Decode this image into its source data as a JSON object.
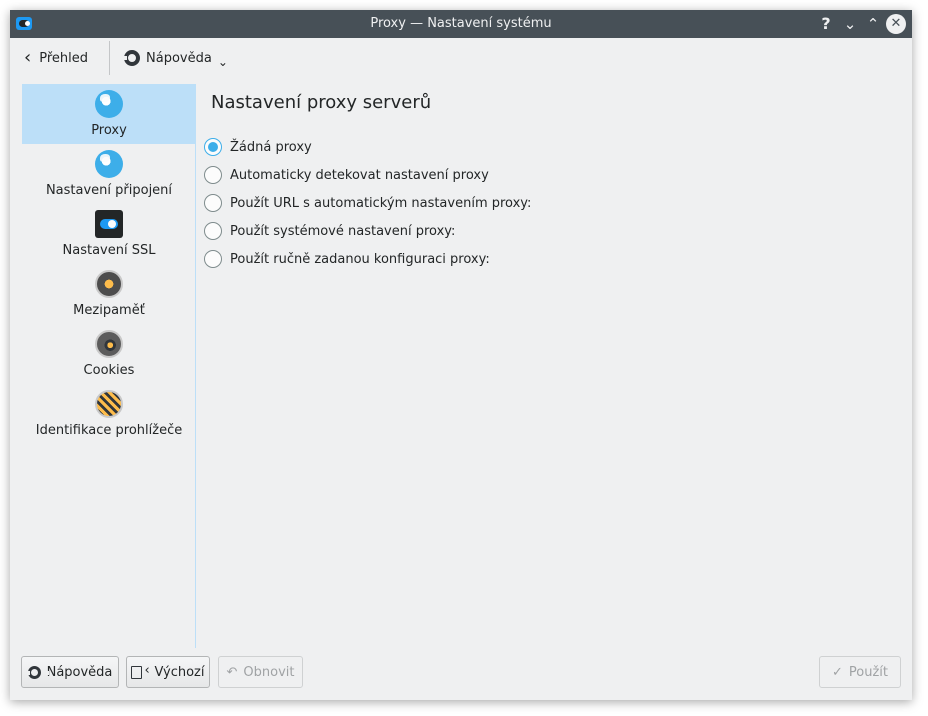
{
  "window": {
    "title": "Proxy  — Nastavení systému"
  },
  "titlebar_buttons": {
    "help": "?",
    "minimize": "⌄",
    "maximize": "⌃",
    "close": "✕"
  },
  "toolbar": {
    "back_label": "Přehled",
    "help_label": "Nápověda"
  },
  "sidebar": {
    "items": [
      {
        "label": "Proxy",
        "icon": "globe-icon",
        "active": true
      },
      {
        "label": "Nastavení připojení",
        "icon": "globe-icon",
        "active": false
      },
      {
        "label": "Nastavení SSL",
        "icon": "toggle-icon",
        "active": false
      },
      {
        "label": "Mezipaměť",
        "icon": "cache-icon",
        "active": false
      },
      {
        "label": "Cookies",
        "icon": "cookie-icon",
        "active": false
      },
      {
        "label": "Identifikace prohlížeče",
        "icon": "browser-id-icon",
        "active": false
      }
    ]
  },
  "main": {
    "heading": "Nastavení proxy serverů",
    "options": [
      {
        "label": "Žádná proxy",
        "checked": true
      },
      {
        "label": "Automaticky detekovat nastavení proxy",
        "checked": false
      },
      {
        "label": "Použít URL s automatickým nastavením proxy:",
        "checked": false
      },
      {
        "label": "Použít systémové nastavení proxy:",
        "checked": false
      },
      {
        "label": "Použít ručně zadanou konfiguraci proxy:",
        "checked": false
      }
    ]
  },
  "footer": {
    "help_label": "Nápověda",
    "defaults_label": "Výchozí",
    "reset_label": "Obnovit",
    "apply_label": "Použít"
  },
  "colors": {
    "accent": "#3daee9",
    "selection": "#bcdff8",
    "titlebar": "#475057",
    "window_bg": "#eff0f1"
  }
}
